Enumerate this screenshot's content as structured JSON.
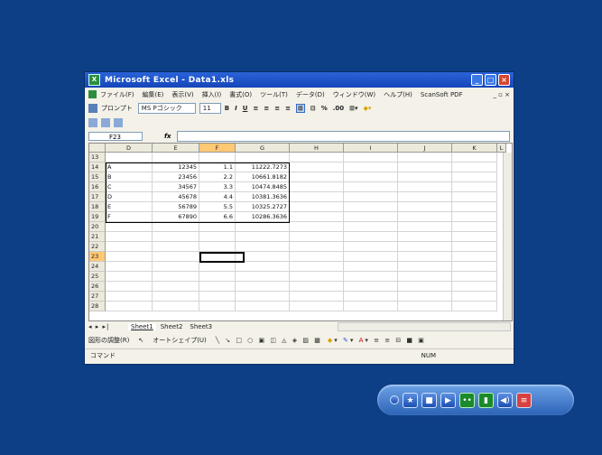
{
  "window": {
    "title": "Microsoft Excel - Data1.xls",
    "app_icon": "excel-icon"
  },
  "menu": {
    "items": [
      "ファイル(F)",
      "編集(E)",
      "表示(V)",
      "挿入(I)",
      "書式(O)",
      "ツール(T)",
      "データ(D)",
      "ウィンドウ(W)",
      "ヘルプ(H)",
      "ScanSoft PDF"
    ]
  },
  "toolbar": {
    "prompt_label": "プロンプト",
    "font_name": "MS Pゴシック",
    "font_size": "11"
  },
  "formula_bar": {
    "name_box": "F23",
    "fx": "fx"
  },
  "sheet": {
    "columns": [
      "D",
      "E",
      "F",
      "G",
      "H",
      "I",
      "J",
      "K",
      "L"
    ],
    "selected_column": "F",
    "rows": [
      {
        "n": "13",
        "D": "",
        "E": "",
        "F": "",
        "G": ""
      },
      {
        "n": "14",
        "D": "A",
        "E": "12345",
        "F": "1.1",
        "G": "11222.7273"
      },
      {
        "n": "15",
        "D": "B",
        "E": "23456",
        "F": "2.2",
        "G": "10661.8182"
      },
      {
        "n": "16",
        "D": "C",
        "E": "34567",
        "F": "3.3",
        "G": "10474.8485"
      },
      {
        "n": "17",
        "D": "D",
        "E": "45678",
        "F": "4.4",
        "G": "10381.3636"
      },
      {
        "n": "18",
        "D": "E",
        "E": "56789",
        "F": "5.5",
        "G": "10325.2727"
      },
      {
        "n": "19",
        "D": "F",
        "E": "67890",
        "F": "6.6",
        "G": "10286.3636"
      },
      {
        "n": "20"
      },
      {
        "n": "21"
      },
      {
        "n": "22"
      },
      {
        "n": "23"
      },
      {
        "n": "24"
      },
      {
        "n": "25"
      },
      {
        "n": "26"
      },
      {
        "n": "27"
      },
      {
        "n": "28"
      }
    ],
    "selected_row": "23",
    "tabs": [
      "Sheet1",
      "Sheet2",
      "Sheet3"
    ],
    "active_tab": "Sheet1"
  },
  "drawing": {
    "draw_label": "図形の調整(R)",
    "autoshape_label": "オートシェイプ(U)"
  },
  "status": {
    "left": "コマンド",
    "num": "NUM"
  },
  "player": {
    "buttons": [
      "dot-icon",
      "star-icon",
      "stop-icon",
      "play-icon",
      "record-icon",
      "signal-icon",
      "volume-icon",
      "toggle-icon"
    ]
  }
}
